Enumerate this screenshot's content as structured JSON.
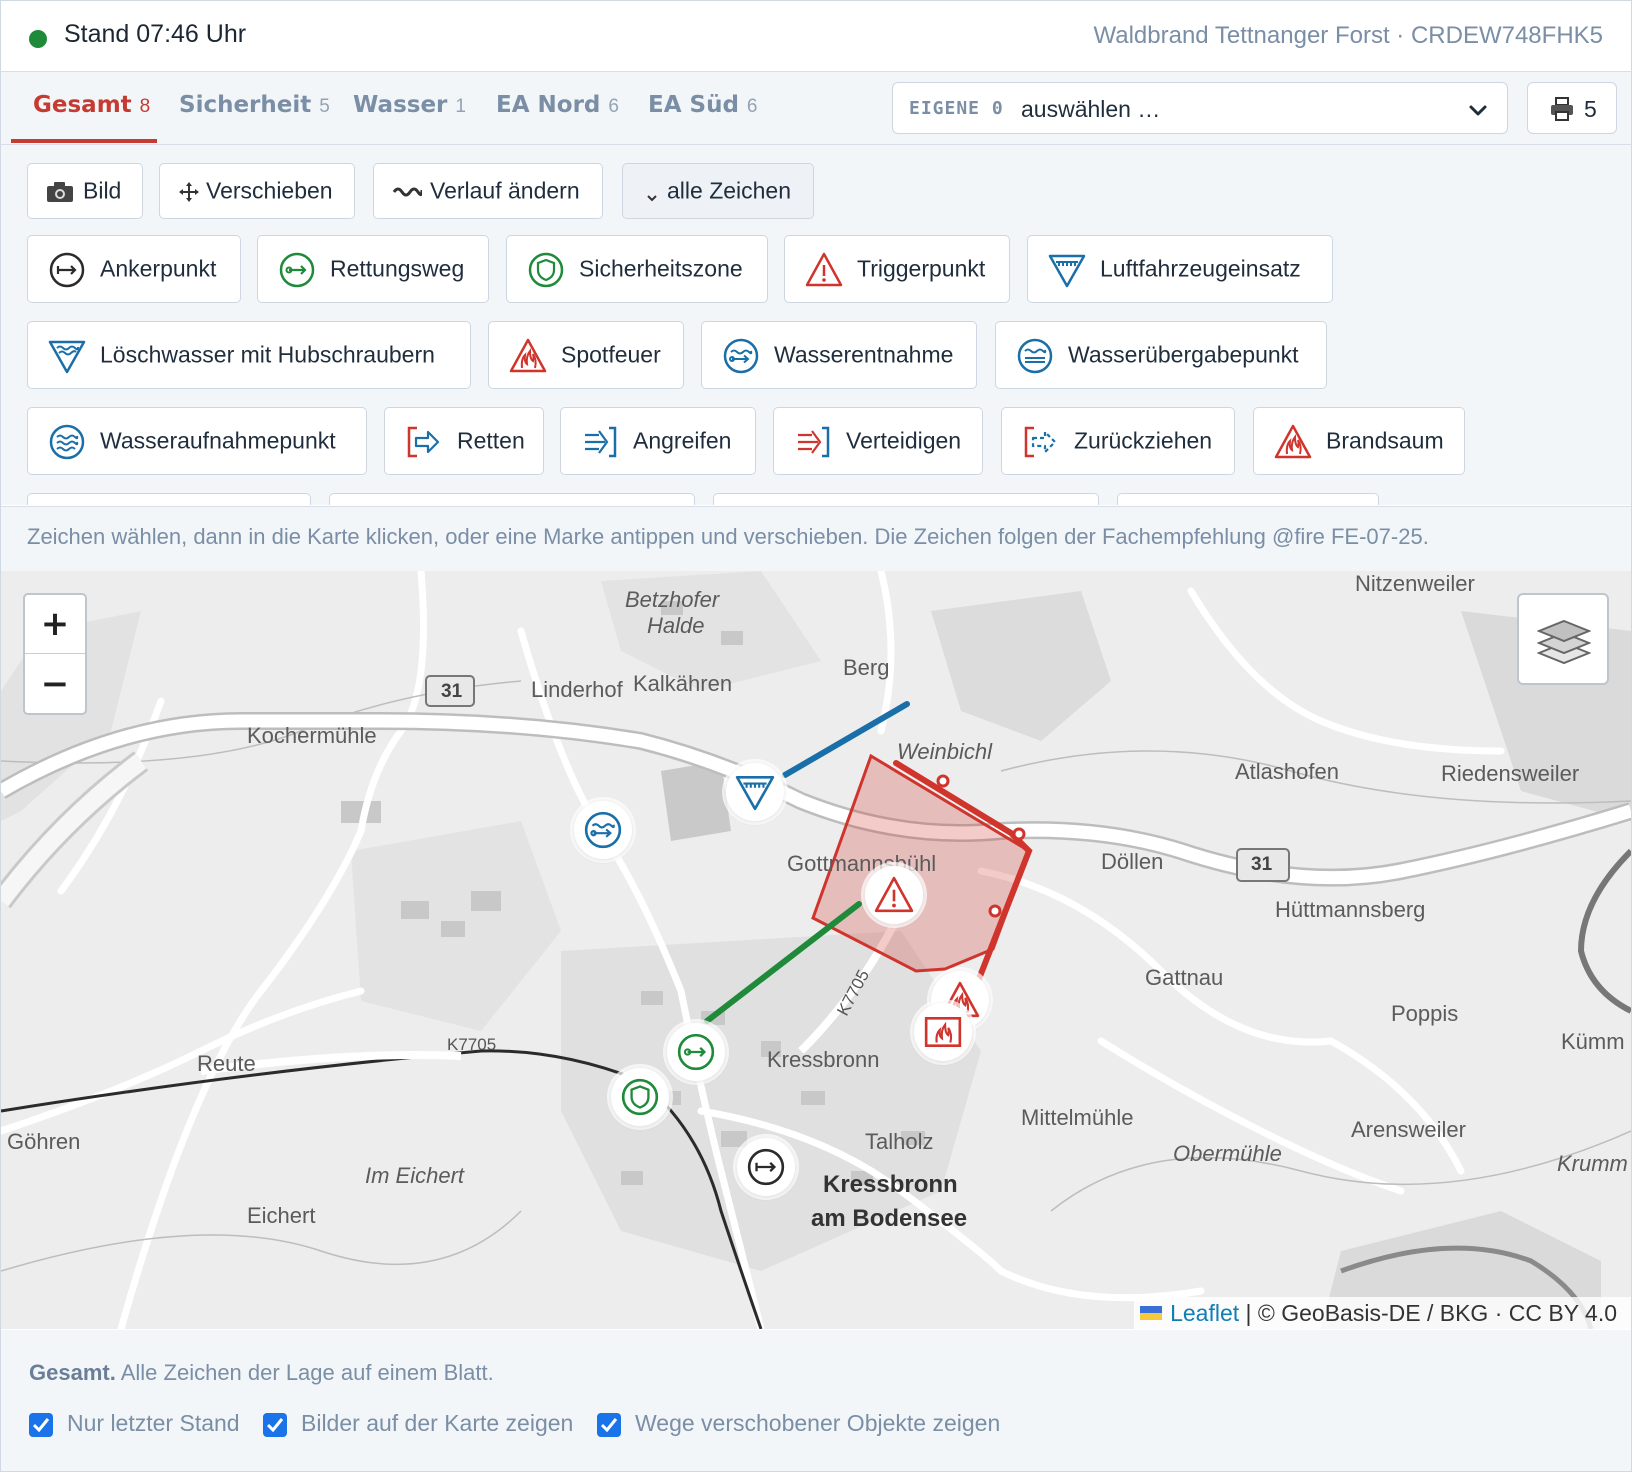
{
  "status": {
    "stand": "Stand 07:46 Uhr",
    "incident": "Waldbrand Tettnanger Forst · CRDEW748FHK5",
    "indicator_color": "#1f8b3a"
  },
  "tabs": [
    {
      "label": "Gesamt",
      "count": "8",
      "active": true
    },
    {
      "label": "Sicherheit",
      "count": "5"
    },
    {
      "label": "Wasser",
      "count": "1"
    },
    {
      "label": "EA Nord",
      "count": "6"
    },
    {
      "label": "EA Süd",
      "count": "6"
    }
  ],
  "own": {
    "label": "EIGENE 0",
    "value": "auswählen …",
    "icon": "chevron-down-icon"
  },
  "print": {
    "count": "5",
    "icon": "printer-icon"
  },
  "tools": [
    {
      "label": "Bild",
      "icon": "camera-icon"
    },
    {
      "label": "Verschieben",
      "icon": "move-icon"
    },
    {
      "label": "Verlauf ändern",
      "icon": "wave-icon"
    },
    {
      "label": "alle Zeichen",
      "icon": "chevron-down-icon"
    }
  ],
  "symbols": [
    {
      "label": "Ankerpunkt",
      "icon": "anchor-point-icon"
    },
    {
      "label": "Rettungsweg",
      "icon": "escape-route-icon"
    },
    {
      "label": "Sicherheitszone",
      "icon": "safety-zone-icon"
    },
    {
      "label": "Triggerpunkt",
      "icon": "trigger-point-icon"
    },
    {
      "label": "Luftfahrzeugeinsatz",
      "icon": "aircraft-icon"
    },
    {
      "label": "Löschwasser mit Hubschraubern",
      "icon": "helicopter-water-icon"
    },
    {
      "label": "Spotfeuer",
      "icon": "spot-fire-icon"
    },
    {
      "label": "Wasserentnahme",
      "icon": "water-extraction-icon"
    },
    {
      "label": "Wasserübergabepunkt",
      "icon": "water-handover-icon"
    },
    {
      "label": "Wasseraufnahmepunkt",
      "icon": "water-intake-icon"
    },
    {
      "label": "Retten",
      "icon": "rescue-icon"
    },
    {
      "label": "Angreifen",
      "icon": "attack-icon"
    },
    {
      "label": "Verteidigen",
      "icon": "defend-icon"
    },
    {
      "label": "Zurückziehen",
      "icon": "withdraw-icon"
    },
    {
      "label": "Brandsaum",
      "icon": "fire-edge-icon"
    }
  ],
  "hint": "Zeichen wählen, dann in die Karte klicken, oder eine Marke antippen und verschieben. Die Zeichen folgen der Fachempfehlung @fire FE-07-25.",
  "map": {
    "zoom_in": "+",
    "zoom_out": "−",
    "attribution_link": "Leaflet",
    "attribution_rest": " | © GeoBasis-DE / BKG · CC BY 4.0",
    "places": [
      "Betzhofer",
      "Halde",
      "Nitzenweiler",
      "Berg",
      "Linderhof",
      "Kalkähren",
      "Kochermühle",
      "Weinbichl",
      "Atlashofen",
      "Riedensweiler",
      "Gottmannsbühl",
      "Döllen",
      "Hüttmannsberg",
      "Gattnau",
      "Poppis",
      "Kümm",
      "Kressbronn",
      "Reute",
      "Mittelmühle",
      "Obermühle",
      "Arensweiler",
      "Krumm",
      "Talholz",
      "Göhren",
      "Im Eichert",
      "Eichert",
      "Kressbronn",
      "am Bodensee"
    ],
    "road_labels": [
      "31",
      "31",
      "K7705",
      "K7705"
    ],
    "colors": {
      "fire": "#d0352d",
      "water": "#1a6fa8",
      "safety": "#1f8b3a",
      "neutral": "#2b2b2b"
    }
  },
  "footer": {
    "title": "Gesamt.",
    "desc": " Alle Zeichen der Lage auf einem Blatt.",
    "checks": [
      {
        "label": "Nur letzter Stand",
        "checked": true
      },
      {
        "label": "Bilder auf der Karte zeigen",
        "checked": true
      },
      {
        "label": "Wege verschobener Objekte zeigen",
        "checked": true
      }
    ]
  }
}
